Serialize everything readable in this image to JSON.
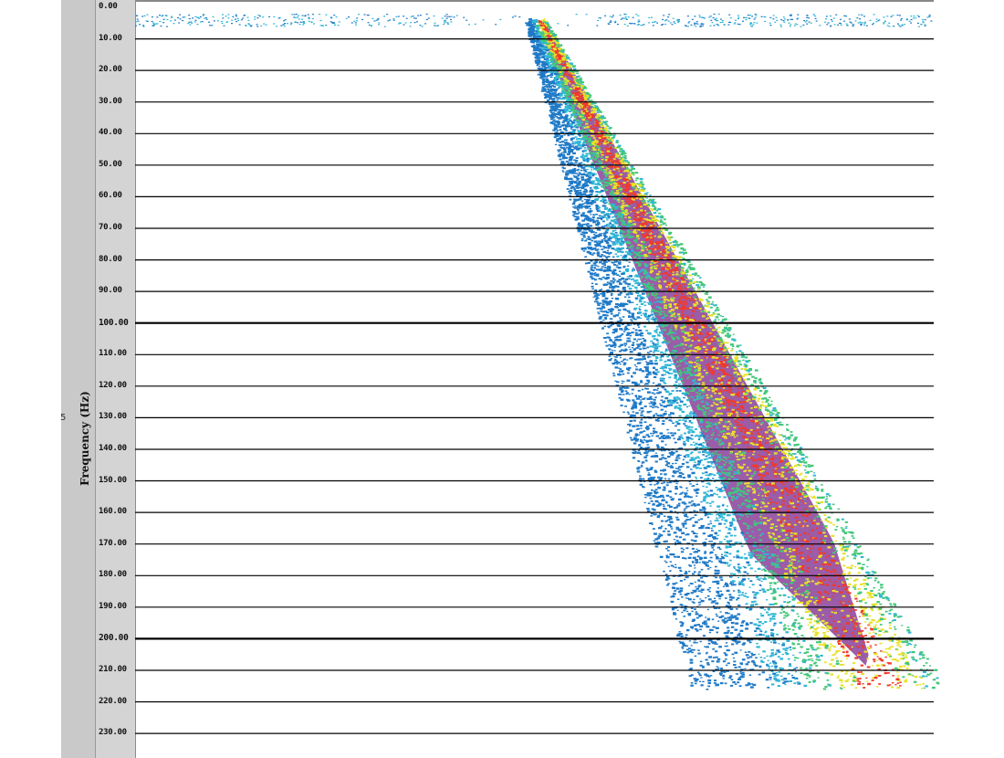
{
  "chart_data": {
    "type": "heatmap",
    "ylabel": "Frequency (Hz)",
    "y_tick_labels": [
      "0.00",
      "10.00",
      "20.00",
      "30.00",
      "40.00",
      "50.00",
      "60.00",
      "70.00",
      "80.00",
      "90.00",
      "100.00",
      "110.00",
      "120.00",
      "130.00",
      "140.00",
      "150.00",
      "160.00",
      "170.00",
      "180.00",
      "190.00",
      "200.00",
      "210.00",
      "220.00",
      "230.00"
    ],
    "y_ticks": [
      0,
      10,
      20,
      30,
      40,
      50,
      60,
      70,
      80,
      90,
      100,
      110,
      120,
      130,
      140,
      150,
      160,
      170,
      180,
      190,
      200,
      210,
      220,
      230
    ],
    "ylim": [
      0,
      240
    ],
    "y_inverted": true,
    "major_gridlines": [
      100,
      200
    ],
    "grid": true,
    "colormap": [
      "#1f7ac7",
      "#2fb7d6",
      "#43c77a",
      "#e8e22a",
      "#f2392b",
      "#9b5ca8"
    ],
    "sweep": {
      "description_points_hz": [
        [
          3,
          5
        ],
        [
          210,
          215
        ]
      ]
    }
  },
  "colors": {
    "background": "#ffffff",
    "axis_panel": "#d4d4d4",
    "left_panel": "#c9c9c9",
    "gridline": "#000000",
    "low": "#1f7ac7",
    "mid_low": "#2fb7d6",
    "mid": "#43c77a",
    "mid_high": "#e8e22a",
    "high": "#f2392b",
    "peak": "#9b5ca8"
  },
  "side_mark": "5"
}
